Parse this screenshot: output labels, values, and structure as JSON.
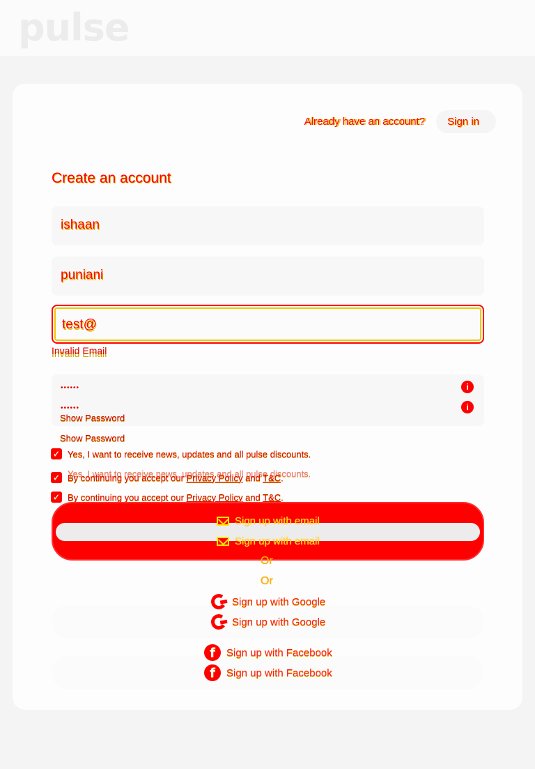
{
  "app": {
    "logo": "pulse"
  },
  "header": {
    "prompt": "Already have an account?",
    "signin_label": "Sign in"
  },
  "form": {
    "title": "Create an account",
    "first_name_value": "ishaan",
    "last_name_value": "puniani",
    "email_value": "test@",
    "email_error": "Invalid Email",
    "password_mask": "••••••",
    "info_glyph": "i",
    "show_password_label": "Show Password",
    "news_opt_in": "Yes, I want to receive news, updates and all pulse discounts.",
    "terms_prefix": "By continuing you accept our ",
    "privacy_link": "Privacy Policy",
    "terms_and": " and ",
    "tc_link": "T&C",
    "terms_suffix": "."
  },
  "actions": {
    "email_signup": "Sign up with email",
    "or_label": "Or",
    "google_signup": "Sign up with Google",
    "facebook_signup": "Sign up with Facebook"
  },
  "icons": {
    "mail": "mail-icon",
    "google": "google-icon",
    "facebook": "facebook-icon",
    "info": "info-icon",
    "check": "checkbox-checked-icon"
  },
  "colors": {
    "accent": "#ff0000",
    "highlight": "#ffe400",
    "background": "#f4f4f4",
    "card": "#fdfdfd"
  }
}
